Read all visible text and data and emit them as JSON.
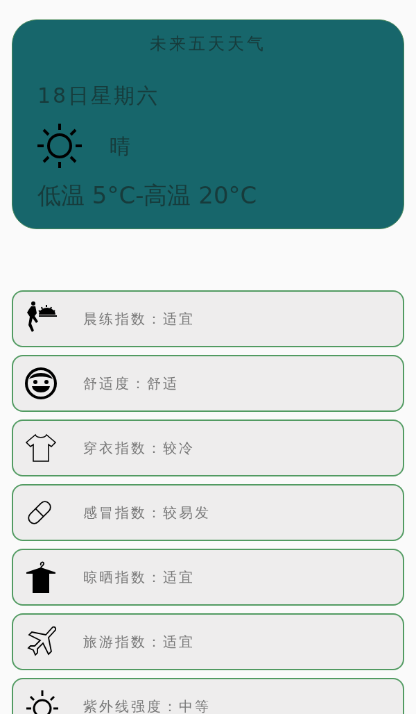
{
  "forecast": {
    "title": "未来五天天气",
    "date": "18日星期六",
    "condition": "晴",
    "temperature": "低温 5°C-高温 20°C"
  },
  "indices": [
    {
      "kind": "exercise",
      "text": "晨练指数：适宜"
    },
    {
      "kind": "comfort",
      "text": "舒适度：舒适"
    },
    {
      "kind": "clothing",
      "text": "穿衣指数：较冷"
    },
    {
      "kind": "cold",
      "text": "感冒指数：较易发"
    },
    {
      "kind": "drying",
      "text": "晾晒指数：适宜"
    },
    {
      "kind": "travel",
      "text": "旅游指数：适宜"
    },
    {
      "kind": "uv",
      "text": "紫外线强度：中等"
    }
  ]
}
